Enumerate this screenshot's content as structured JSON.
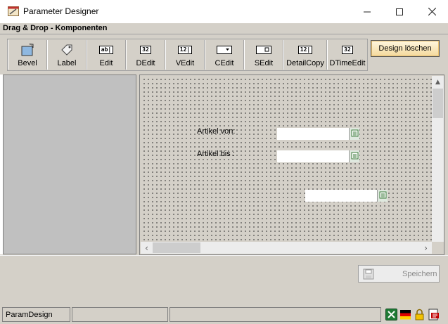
{
  "window": {
    "title": "Parameter Designer",
    "section_label": "Drag & Drop - Komponenten"
  },
  "palette": {
    "items": [
      {
        "label": "Bevel",
        "icon": "bevel-icon"
      },
      {
        "label": "Label",
        "icon": "label-tag-icon"
      },
      {
        "label": "Edit",
        "icon": "edit-field-icon",
        "glyph": "ab|"
      },
      {
        "label": "DEdit",
        "icon": "date-edit-icon",
        "glyph": "32"
      },
      {
        "label": "VEdit",
        "icon": "value-edit-icon",
        "glyph": "12|"
      },
      {
        "label": "CEdit",
        "icon": "combo-edit-icon"
      },
      {
        "label": "SEdit",
        "icon": "spin-edit-icon"
      },
      {
        "label": "DetailCopy",
        "icon": "detail-copy-icon",
        "glyph": "12|"
      },
      {
        "label": "DTimeEdit",
        "icon": "datetime-edit-icon",
        "glyph": "32"
      }
    ],
    "delete_design_label": "Design löschen"
  },
  "canvas": {
    "fields": [
      {
        "label": "Artikel von:",
        "value": ""
      },
      {
        "label": "Artikel bis :",
        "value": ""
      },
      {
        "label": "",
        "value": ""
      }
    ]
  },
  "actions": {
    "save_label": "Speichern"
  },
  "statusbar": {
    "panel1": "ParamDesign",
    "panel2": "",
    "panel3": "",
    "icons": [
      "excel-icon",
      "german-flag-icon",
      "lock-icon",
      "pdf-icon"
    ]
  },
  "colors": {
    "accent_button": "#f4d99c",
    "canvas_bg": "#d4d0c8",
    "left_panel": "#c0c0c0"
  }
}
